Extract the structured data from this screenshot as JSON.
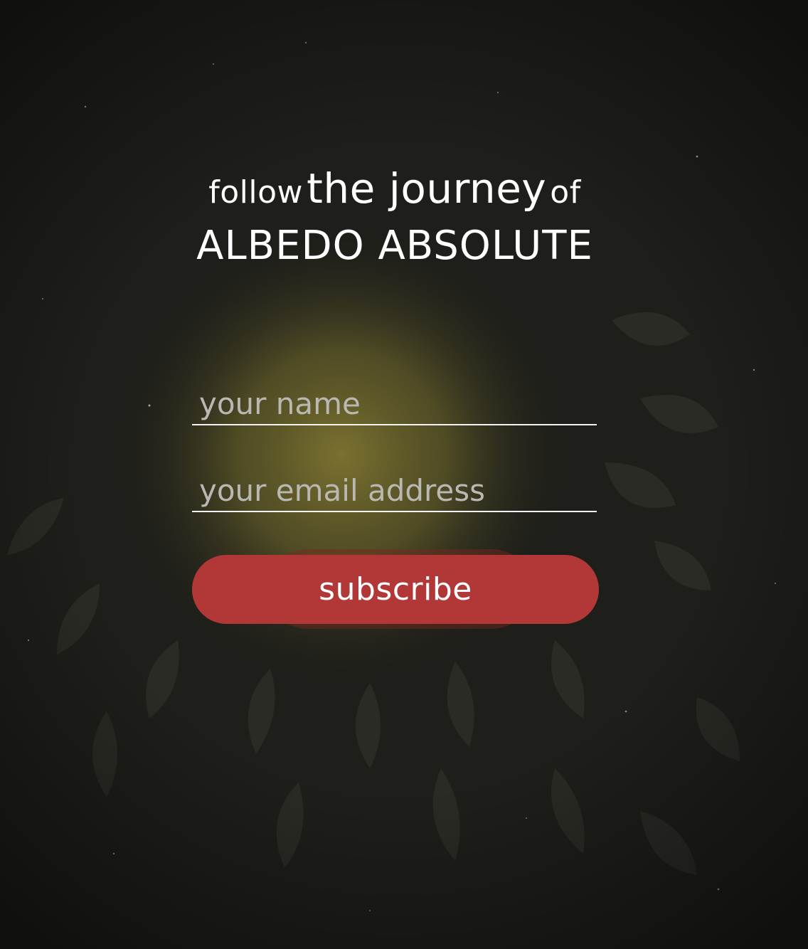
{
  "headline": {
    "part1": "follow",
    "part2": "the journey",
    "part3": "of",
    "title": "ALBEDO ABSOLUTE"
  },
  "form": {
    "name_placeholder": "your name",
    "email_placeholder": "your email address",
    "subscribe_label": "subscribe"
  },
  "colors": {
    "background": "#1e1e1a",
    "glow": "#8a7a2c",
    "button": "#b23838",
    "text": "#ffffff",
    "placeholder": "#b9b8b2"
  }
}
